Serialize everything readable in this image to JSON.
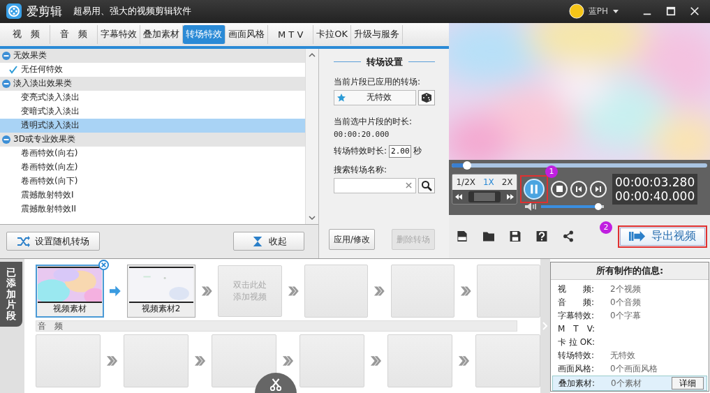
{
  "app": {
    "name": "爱剪辑",
    "slogan": "超易用、强大的视频剪辑软件",
    "user": "蓝PH"
  },
  "tabs": [
    {
      "label": "视　频",
      "selected": false
    },
    {
      "label": "音　频",
      "selected": false
    },
    {
      "label": "字幕特效",
      "selected": false
    },
    {
      "label": "叠加素材",
      "selected": false
    },
    {
      "label": "转场特效",
      "selected": true
    },
    {
      "label": "画面风格",
      "selected": false
    },
    {
      "label": "M T V",
      "selected": false
    },
    {
      "label": "卡拉OK",
      "selected": false
    },
    {
      "label": "升级与服务",
      "selected": false
    }
  ],
  "effect_tree": [
    {
      "label": "无效果类",
      "expanded": true,
      "children": [
        {
          "label": "无任何特效",
          "checked": true,
          "selected": false
        }
      ]
    },
    {
      "label": "淡入淡出效果类",
      "expanded": true,
      "children": [
        {
          "label": "变亮式淡入淡出",
          "checked": false,
          "selected": false
        },
        {
          "label": "变暗式淡入淡出",
          "checked": false,
          "selected": false
        },
        {
          "label": "透明式淡入淡出",
          "checked": false,
          "selected": true
        }
      ]
    },
    {
      "label": "3D或专业效果类",
      "expanded": true,
      "children": [
        {
          "label": "卷画特效(向右)",
          "checked": false,
          "selected": false
        },
        {
          "label": "卷画特效(向左)",
          "checked": false,
          "selected": false
        },
        {
          "label": "卷画特效(向下)",
          "checked": false,
          "selected": false
        },
        {
          "label": "震撼散射特效I",
          "checked": false,
          "selected": false
        },
        {
          "label": "震撼散射特效II",
          "checked": false,
          "selected": false
        }
      ]
    }
  ],
  "list_buttons": {
    "random": "设置随机转场",
    "collapse": "收起"
  },
  "transition_settings": {
    "title": "转场设置",
    "applied_label": "当前片段已应用的转场:",
    "applied_value": "无特效",
    "duration_label": "当前选中片段的时长:",
    "duration_value": "00:00:20.000",
    "effect_duration_label": "转场特效时长:",
    "effect_duration_value": "2.00",
    "unit": "秒",
    "search_label": "搜索转场名称:",
    "apply_button": "应用/修改",
    "delete_button": {
      "label": "删除转场",
      "disabled": true
    }
  },
  "player": {
    "progress": {
      "level": 0.06
    },
    "speeds": [
      {
        "label": "1/2X",
        "selected": false
      },
      {
        "label": "1X",
        "selected": true
      },
      {
        "label": "2X",
        "selected": false
      }
    ],
    "current_time": "00:00:03.280",
    "total_time": "00:00:40.000",
    "volume": {
      "level": 0.97
    },
    "export_button": "导出视频",
    "pause_annotation": "1",
    "export_annotation": "2"
  },
  "clips_tab": "已添加片段",
  "video_track": [
    {
      "kind": "clip",
      "label": "视频素材",
      "selected": true
    },
    {
      "kind": "clip",
      "label": "视频素材2",
      "selected": false
    },
    {
      "kind": "add",
      "label": "双击此处添加视频"
    },
    {
      "kind": "empty"
    },
    {
      "kind": "empty"
    },
    {
      "kind": "empty"
    }
  ],
  "audio_track": {
    "label": "音　频",
    "slots": [
      {
        "kind": "empty"
      },
      {
        "kind": "empty"
      },
      {
        "kind": "empty"
      },
      {
        "kind": "empty"
      },
      {
        "kind": "empty"
      },
      {
        "kind": "empty"
      }
    ]
  },
  "info_panel": {
    "title": "所有制作的信息:",
    "rows": [
      {
        "label": "视　　频:",
        "value": "2个视频",
        "selected": false
      },
      {
        "label": "音　　频:",
        "value": "0个音频",
        "selected": false
      },
      {
        "label": "字幕特效:",
        "value": "0个字幕",
        "selected": false
      },
      {
        "label": "M　T　V:",
        "selected": false
      },
      {
        "label": "卡 拉 OK:",
        "selected": false
      },
      {
        "label": "转场特效:",
        "value": "无特效",
        "selected": false
      },
      {
        "label": "画面风格:",
        "value": "0个画面风格",
        "selected": false
      },
      {
        "label": "叠加素材:",
        "value": "0个素材",
        "selected": true
      }
    ],
    "detail_button": "详细"
  }
}
